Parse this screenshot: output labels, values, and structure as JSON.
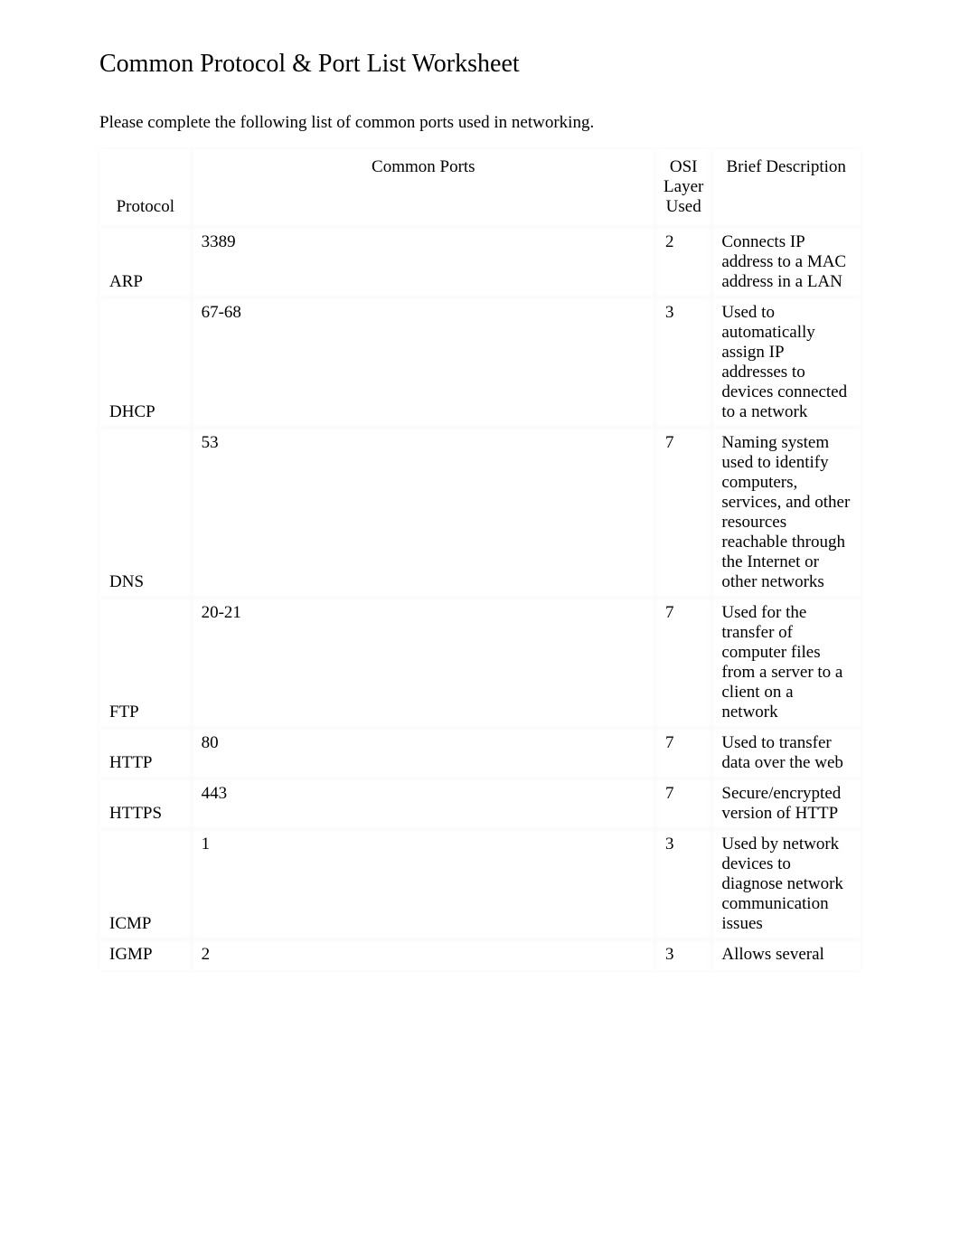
{
  "title": "Common Protocol & Port List Worksheet",
  "instruction": "Please complete the following list of common ports used in networking.",
  "headers": {
    "protocol": "Protocol",
    "ports": "Common Ports",
    "osi": "OSI Layer Used",
    "desc": "Brief Description"
  },
  "rows": [
    {
      "protocol": "ARP",
      "ports": "3389",
      "osi": "2",
      "desc": "Connects IP address to a MAC address in a LAN"
    },
    {
      "protocol": "DHCP",
      "ports": "67-68",
      "osi": "3",
      "desc": "Used to automatically assign IP addresses to devices connected to a network"
    },
    {
      "protocol": "DNS",
      "ports": "53",
      "osi": "7",
      "desc": "Naming system used to identify computers, services, and other resources reachable through the Internet or other networks"
    },
    {
      "protocol": "FTP",
      "ports": "20-21",
      "osi": "7",
      "desc": "Used for the transfer of computer files from a server to a client on a network"
    },
    {
      "protocol": "HTTP",
      "ports": "80",
      "osi": "7",
      "desc": "Used to transfer data over the web"
    },
    {
      "protocol": "HTTPS",
      "ports": "443",
      "osi": "7",
      "desc": "Secure/encrypted version of HTTP"
    },
    {
      "protocol": "ICMP",
      "ports": "1",
      "osi": "3",
      "desc": "Used by network devices to diagnose network communication issues"
    },
    {
      "protocol": "IGMP",
      "ports": "2",
      "osi": "3",
      "desc": "Allows several"
    }
  ]
}
